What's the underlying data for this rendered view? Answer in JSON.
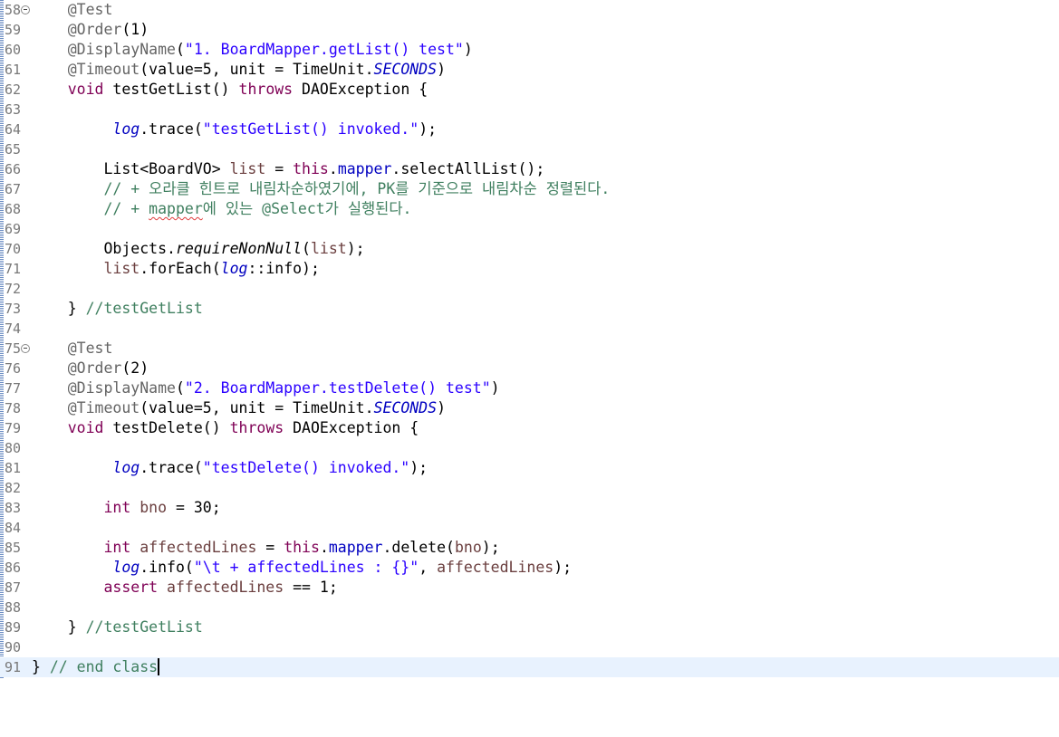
{
  "editor": {
    "lines": {
      "l58": {
        "num": "58",
        "annotation": "@Test"
      },
      "l59": {
        "num": "59",
        "annotation": "@Order",
        "args": "(1)"
      },
      "l60": {
        "num": "60",
        "annotation": "@DisplayName",
        "open": "(",
        "string": "\"1. BoardMapper.getList() test\"",
        "close": ")"
      },
      "l61": {
        "num": "61",
        "annotation": "@Timeout",
        "pre": "(value=5, unit = TimeUnit.",
        "const": "SECONDS",
        "post": ")"
      },
      "l62": {
        "num": "62",
        "kw1": "void",
        "mid": " testGetList() ",
        "kw2": "throws",
        "post": " DAOException {"
      },
      "l63": {
        "num": "63"
      },
      "l64": {
        "num": "64",
        "field": "log",
        "pre": ".trace(",
        "string": "\"testGetList() invoked.\"",
        "post": ");"
      },
      "l65": {
        "num": "65"
      },
      "l66": {
        "num": "66",
        "pre": "List<BoardVO> ",
        "var": "list",
        "mid": " = ",
        "kw": "this",
        "dot": ".",
        "field": "mapper",
        "post": ".selectAllList();"
      },
      "l67": {
        "num": "67",
        "comment": "// + 오라클 힌트로 내림차순하였기에, PK를 기준으로 내림차순 정렬된다."
      },
      "l68": {
        "num": "68",
        "comment_pre": "// + ",
        "comment_squiggle": "mapper",
        "comment_post": "에 있는 @Select가 실행된다."
      },
      "l69": {
        "num": "69"
      },
      "l70": {
        "num": "70",
        "pre": "Objects.",
        "method": "requireNonNull",
        "open": "(",
        "var": "list",
        "post": ");"
      },
      "l71": {
        "num": "71",
        "var": "list",
        "pre": ".forEach(",
        "field": "log",
        "post": "::info);"
      },
      "l72": {
        "num": "72"
      },
      "l73": {
        "num": "73",
        "pre": "} ",
        "comment": "//testGetList"
      },
      "l74": {
        "num": "74"
      },
      "l75": {
        "num": "75",
        "annotation": "@Test"
      },
      "l76": {
        "num": "76",
        "annotation": "@Order",
        "args": "(2)"
      },
      "l77": {
        "num": "77",
        "annotation": "@DisplayName",
        "open": "(",
        "string": "\"2. BoardMapper.testDelete() test\"",
        "close": ")"
      },
      "l78": {
        "num": "78",
        "annotation": "@Timeout",
        "pre": "(value=5, unit = TimeUnit.",
        "const": "SECONDS",
        "post": ")"
      },
      "l79": {
        "num": "79",
        "kw1": "void",
        "mid": " testDelete() ",
        "kw2": "throws",
        "post": " DAOException {"
      },
      "l80": {
        "num": "80"
      },
      "l81": {
        "num": "81",
        "field": "log",
        "pre": ".trace(",
        "string": "\"testDelete() invoked.\"",
        "post": ");"
      },
      "l82": {
        "num": "82"
      },
      "l83": {
        "num": "83",
        "kw": "int",
        "sp": " ",
        "var": "bno",
        "post": " = 30;"
      },
      "l84": {
        "num": "84"
      },
      "l85": {
        "num": "85",
        "kw1": "int",
        "sp": " ",
        "var1": "affectedLines",
        "mid": " = ",
        "kw2": "this",
        "dot": ".",
        "field": "mapper",
        "pre2": ".delete(",
        "var2": "bno",
        "post": ");"
      },
      "l86": {
        "num": "86",
        "field": "log",
        "pre": ".info(",
        "string": "\"\\t + affectedLines : {}\"",
        "comma": ", ",
        "var": "affectedLines",
        "post": ");"
      },
      "l87": {
        "num": "87",
        "kw": "assert",
        "sp": " ",
        "var": "affectedLines",
        "post": " == 1;"
      },
      "l88": {
        "num": "88"
      },
      "l89": {
        "num": "89",
        "pre": "} ",
        "comment": "//testGetList"
      },
      "l90": {
        "num": "90"
      },
      "l91": {
        "num": "91",
        "pre": "} ",
        "comment": "// end class"
      }
    }
  }
}
